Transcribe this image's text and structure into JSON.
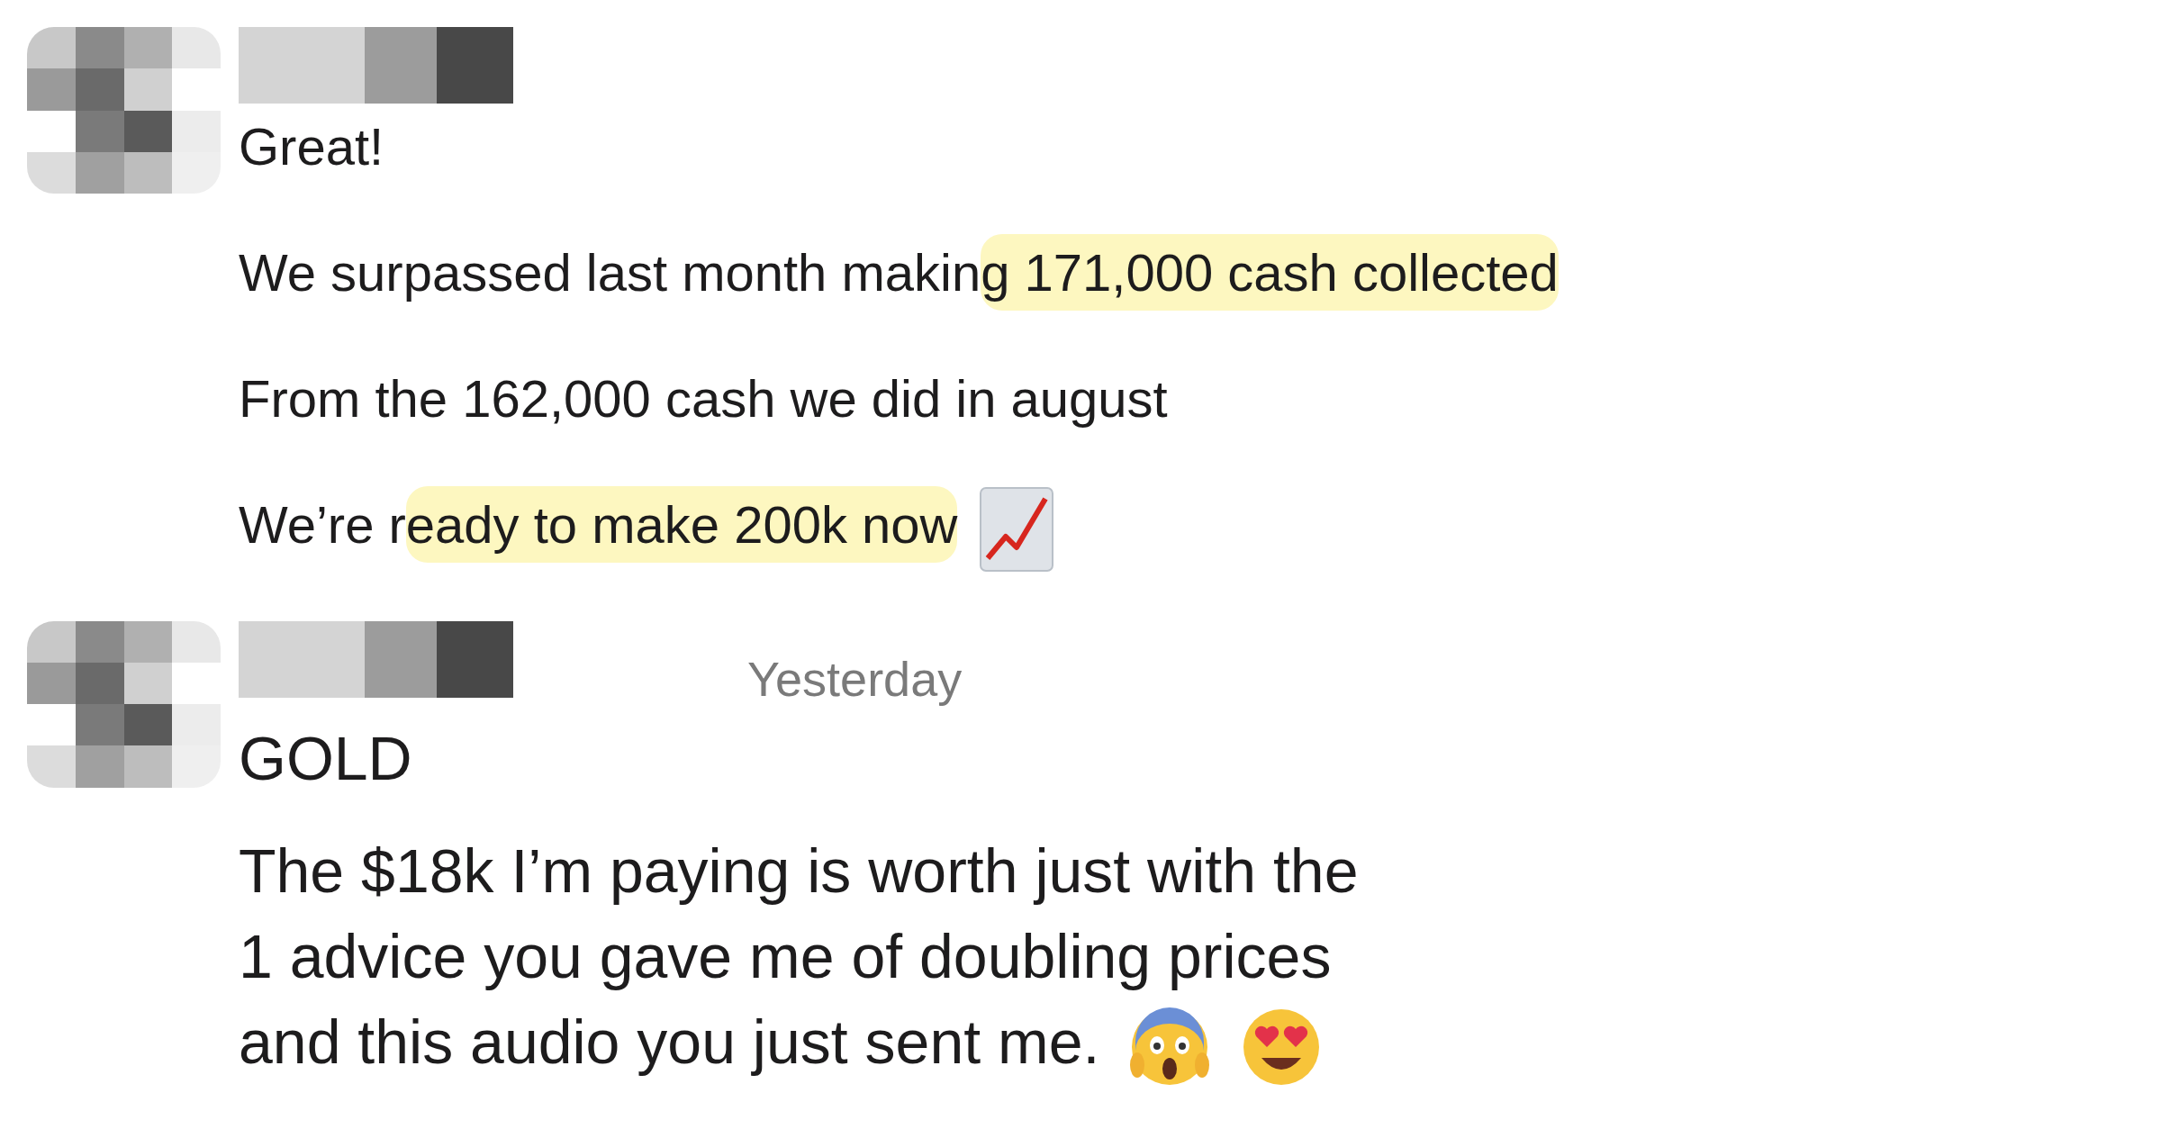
{
  "messages": [
    {
      "paragraphs": [
        {
          "kind": "plain",
          "segments": [
            {
              "text": "Great!",
              "highlighted": false
            }
          ]
        },
        {
          "kind": "plain",
          "segments": [
            {
              "text": "We surpassed last month makin",
              "highlighted": false
            },
            {
              "text": "g 171,000 cash collected",
              "highlighted": true
            }
          ]
        },
        {
          "kind": "plain",
          "segments": [
            {
              "text": "From the 162,000 cash we did in august",
              "highlighted": false
            }
          ]
        },
        {
          "kind": "chart_ending",
          "segments": [
            {
              "text": "We’re r",
              "highlighted": false
            },
            {
              "text": "eady to make 200k now",
              "highlighted": true
            }
          ]
        }
      ]
    },
    {
      "timestamp": "Yesterday",
      "paragraphs": [
        {
          "kind": "plain",
          "segments": [
            {
              "text": "GOLD",
              "highlighted": false
            }
          ]
        },
        {
          "kind": "reaction_ending",
          "lines": [
            "The $18k I’m paying is worth just with the",
            "1 advice you gave me of doubling prices",
            "and this audio you just sent me."
          ]
        }
      ]
    }
  ]
}
